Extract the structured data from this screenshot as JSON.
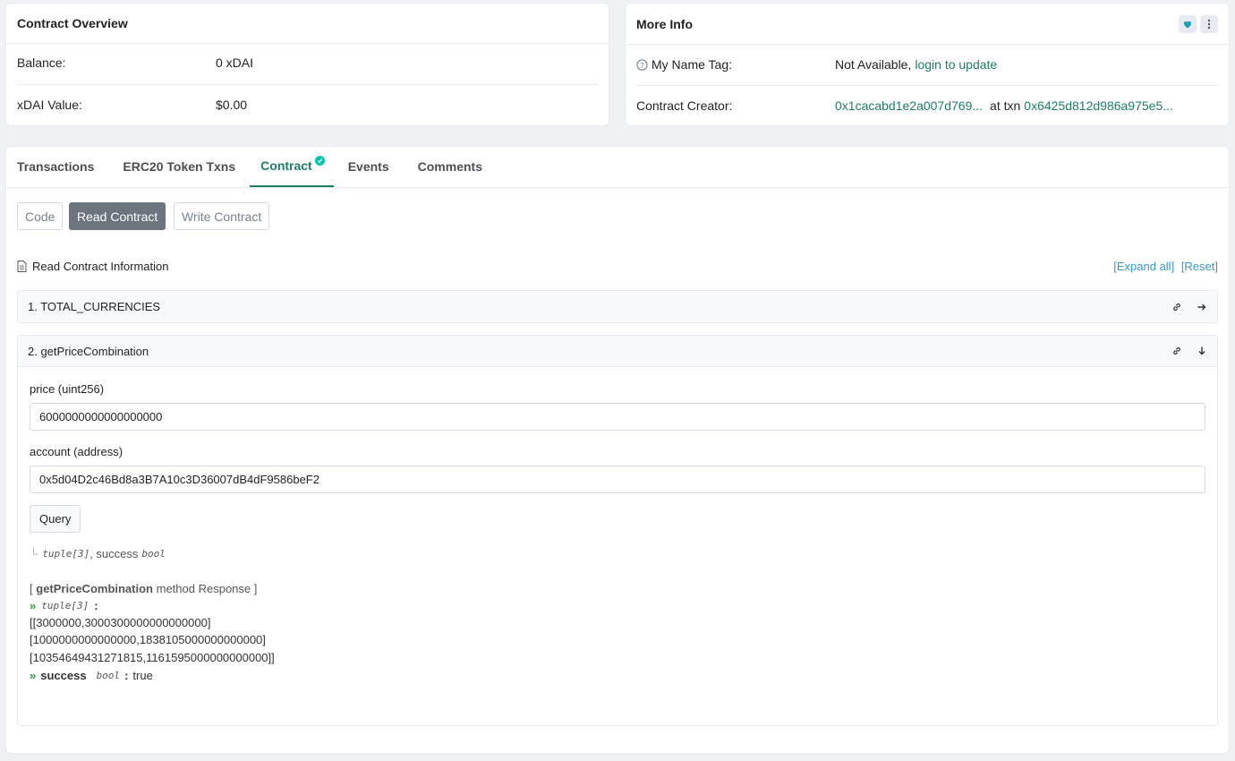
{
  "overview": {
    "title": "Contract Overview",
    "balance_label": "Balance:",
    "balance_value": "0 xDAI",
    "value_label": "xDAI Value:",
    "value_value": "$0.00"
  },
  "more_info": {
    "title": "More Info",
    "name_tag_label": "My Name Tag:",
    "name_tag_value": "Not Available,",
    "login_link": "login to update",
    "creator_label": "Contract Creator:",
    "creator_address": "0x1cacabd1e2a007d769...",
    "at_txn": "at txn",
    "txn_hash": "0x6425d812d986a975e5..."
  },
  "tabs": [
    {
      "label": "Transactions"
    },
    {
      "label": "ERC20 Token Txns"
    },
    {
      "label": "Contract"
    },
    {
      "label": "Events"
    },
    {
      "label": "Comments"
    }
  ],
  "subtabs": {
    "code": "Code",
    "read": "Read Contract",
    "write": "Write Contract"
  },
  "read_section": {
    "title": "Read Contract Information",
    "expand_all": "[Expand all]",
    "reset": "[Reset]"
  },
  "functions": [
    {
      "label": "1. TOTAL_CURRENCIES"
    },
    {
      "label": "2. getPriceCombination",
      "inputs": [
        {
          "label": "price (uint256)",
          "value": "6000000000000000000"
        },
        {
          "label": "account (address)",
          "value": "0x5d04D2c46Bd8a3B7A10c3D36007dB4dF9586beF2"
        }
      ],
      "query_label": "Query",
      "outputs_sig_type1": "tuple[3]",
      "outputs_sig_sep": ", success",
      "outputs_sig_type2": "bool",
      "response_open": "[",
      "response_name": "getPriceCombination",
      "response_close": "method Response ]",
      "out1_type": "tuple[3]",
      "out1_sep": ":",
      "out1_lines": [
        "[[3000000,3000300000000000000]",
        "[1000000000000000,1838105000000000000]",
        "[10354649431271815,1161595000000000000]]"
      ],
      "out2_name": "success",
      "out2_type": "bool",
      "out2_sep": ":",
      "out2_value": "true"
    }
  ],
  "colors": {
    "accent": "#1a7f64",
    "link_blue": "#3498db",
    "check_teal": "#00c9a7",
    "active_pill": "#6c757d"
  }
}
